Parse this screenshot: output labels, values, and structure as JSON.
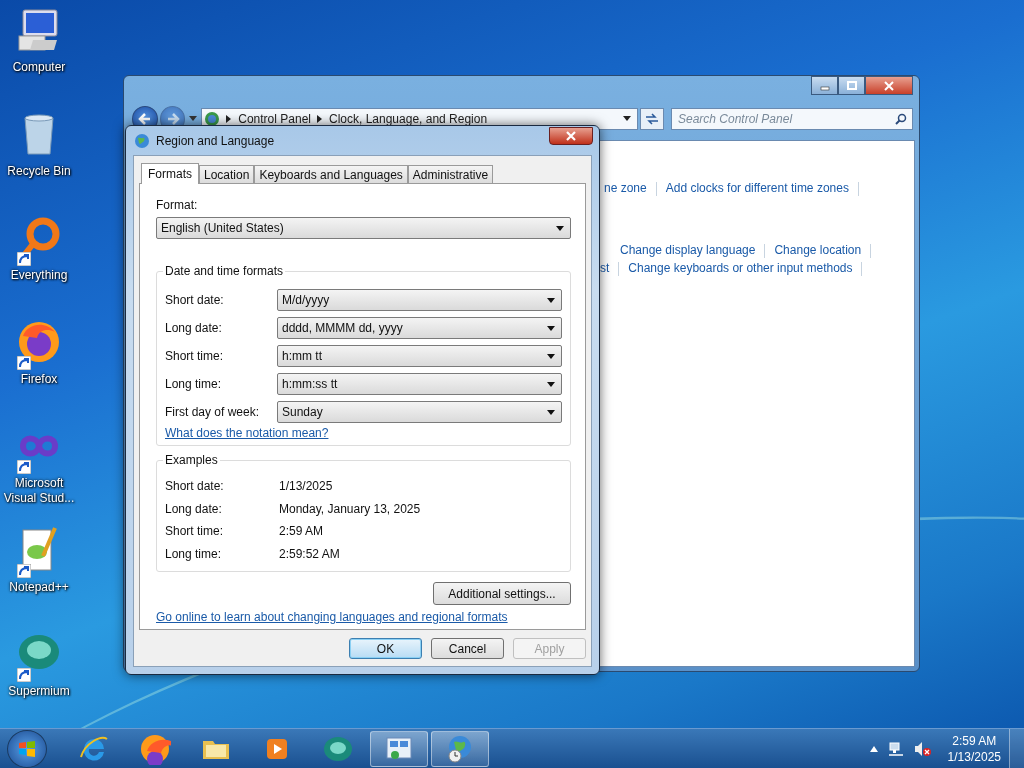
{
  "desktop_icons": [
    {
      "label": "Computer",
      "kind": "computer",
      "shortcut": false
    },
    {
      "label": "Recycle Bin",
      "kind": "bin",
      "shortcut": false
    },
    {
      "label": "Everything",
      "kind": "ring",
      "shortcut": true
    },
    {
      "label": "Firefox",
      "kind": "firefox",
      "shortcut": true
    },
    {
      "label": "Microsoft Visual Stud...",
      "kind": "infinity",
      "shortcut": true
    },
    {
      "label": "Notepad++",
      "kind": "notepad",
      "shortcut": true
    },
    {
      "label": "Supermium",
      "kind": "supermium",
      "shortcut": true
    }
  ],
  "control_panel": {
    "breadcrumb": [
      "Control Panel",
      "Clock, Language, and Region"
    ],
    "search": {
      "placeholder": "Search Control Panel"
    },
    "link_rows": [
      [
        "ne zone",
        "Add clocks for different time zones"
      ],
      [
        "Change display language",
        "Change location"
      ],
      [
        "st",
        "Change keyboards or other input methods"
      ]
    ]
  },
  "dialog": {
    "title": "Region and Language",
    "tabs": [
      {
        "label": "Formats",
        "selected": true
      },
      {
        "label": "Location",
        "selected": false
      },
      {
        "label": "Keyboards and Languages",
        "selected": false
      },
      {
        "label": "Administrative",
        "selected": false
      }
    ],
    "format": {
      "label": "Format:",
      "value": "English (United States)"
    },
    "formats_group": {
      "title": "Date and time formats",
      "rows": [
        {
          "label": "Short date:",
          "value": "M/d/yyyy"
        },
        {
          "label": "Long date:",
          "value": "dddd, MMMM dd, yyyy"
        },
        {
          "label": "Short time:",
          "value": "h:mm tt"
        },
        {
          "label": "Long time:",
          "value": "h:mm:ss tt"
        },
        {
          "label": "First day of week:",
          "value": "Sunday"
        }
      ],
      "link": "What does the notation mean?"
    },
    "examples_group": {
      "title": "Examples",
      "rows": [
        {
          "label": "Short date:",
          "value": "1/13/2025"
        },
        {
          "label": "Long date:",
          "value": "Monday, January 13, 2025"
        },
        {
          "label": "Short time:",
          "value": "2:59 AM"
        },
        {
          "label": "Long time:",
          "value": "2:59:52 AM"
        }
      ]
    },
    "additional_button": "Additional settings...",
    "online_link": "Go online to learn about changing languages and regional formats",
    "buttons": [
      {
        "label": "OK",
        "default": true,
        "disabled": false
      },
      {
        "label": "Cancel",
        "default": false,
        "disabled": false
      },
      {
        "label": "Apply",
        "default": false,
        "disabled": true
      }
    ]
  },
  "taskbar": {
    "items": [
      {
        "kind": "ie",
        "running": false
      },
      {
        "kind": "firefox",
        "running": false
      },
      {
        "kind": "folder",
        "running": false
      },
      {
        "kind": "media",
        "running": false
      },
      {
        "kind": "supermium",
        "running": false
      },
      {
        "kind": "panel",
        "running": true
      },
      {
        "kind": "globe",
        "running": true
      }
    ],
    "clock": {
      "time": "2:59 AM",
      "date": "1/13/2025"
    }
  }
}
